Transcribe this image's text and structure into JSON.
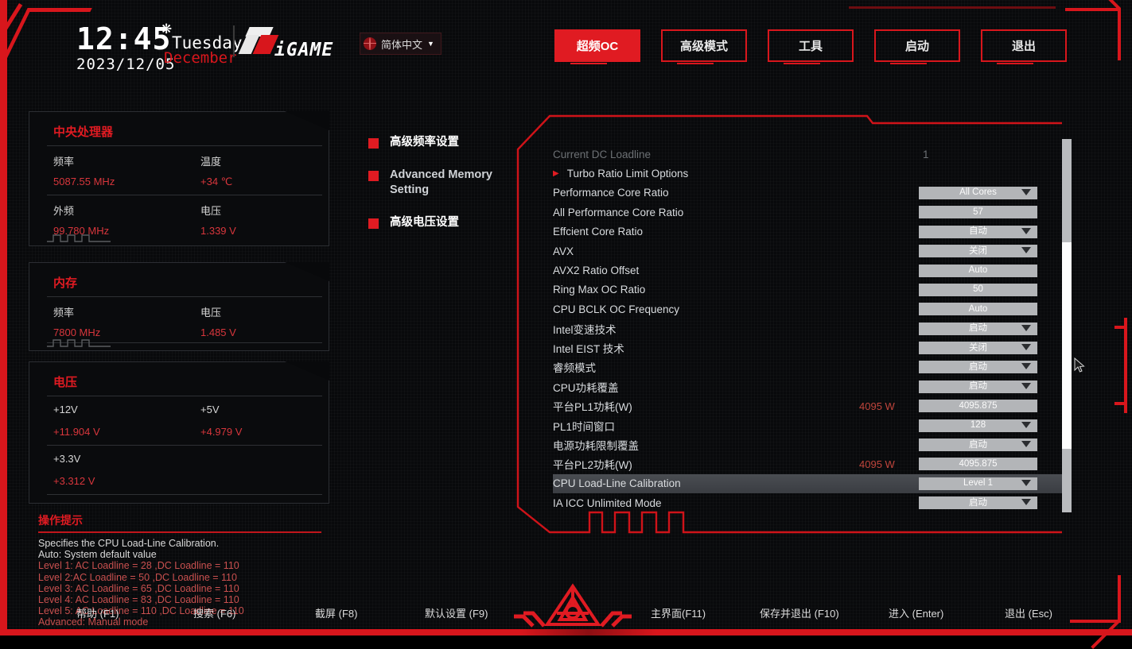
{
  "header": {
    "time": "12:45",
    "date": "2023/12/05",
    "day_of_week": "Tuesday",
    "month": "December",
    "gear_icon": "gear-icon",
    "brand": "iGAME",
    "language": {
      "label": "简体中文",
      "caret": "▼",
      "globe_icon": "globe-icon"
    },
    "nav": [
      {
        "label": "超频OC",
        "active": true
      },
      {
        "label": "高级模式",
        "active": false
      },
      {
        "label": "工具",
        "active": false
      },
      {
        "label": "启动",
        "active": false
      },
      {
        "label": "退出",
        "active": false
      }
    ]
  },
  "sidebar": {
    "cpu": {
      "title": "中央处理器",
      "fields": [
        {
          "label": "频率",
          "value": "5087.55 MHz"
        },
        {
          "label": "温度",
          "value": "+34 ℃"
        },
        {
          "label": "外频",
          "value": "99.780 MHz"
        },
        {
          "label": "电压",
          "value": "1.339 V"
        }
      ]
    },
    "memory": {
      "title": "内存",
      "fields": [
        {
          "label": "频率",
          "value": "7800 MHz"
        },
        {
          "label": "电压",
          "value": "1.485 V"
        }
      ]
    },
    "voltage": {
      "title": "电压",
      "fields": [
        {
          "label": "+12V",
          "value": "+11.904 V"
        },
        {
          "label": "+5V",
          "value": "+4.979 V"
        },
        {
          "label": "+3.3V",
          "value": "+3.312 V"
        }
      ]
    },
    "help": {
      "title": "操作提示",
      "lines": [
        "Specifies the CPU Load-Line Calibration.",
        "Auto: System default value",
        "Level 1: AC Loadline = 28 ,DC Loadline = 110",
        "Level 2:AC Loadline = 50 ,DC Loadline = 110",
        "Level 3: AC Loadline = 65 ,DC Loadline = 110",
        "Level 4: AC Loadline = 83 ,DC Loadline = 110",
        "Level 5: AC Loadline = 110 ,DC Loadline = 110",
        "Advanced: Manual mode"
      ]
    }
  },
  "midmenu": [
    {
      "label": "高级频率设置",
      "lang": "zh"
    },
    {
      "label": "Advanced Memory Setting",
      "lang": "en"
    },
    {
      "label": "高级电压设置",
      "lang": "zh"
    }
  ],
  "settings": {
    "rows": [
      {
        "label": "Current DC Loadline",
        "kind": "readonly",
        "value": "1",
        "dim": true
      },
      {
        "label": "Turbo Ratio Limit Options",
        "kind": "submenu",
        "arrow": "▶"
      },
      {
        "label": "Performance Core Ratio",
        "kind": "dropdown",
        "value": "All Cores"
      },
      {
        "label": "All Performance Core Ratio",
        "kind": "input",
        "value": "57"
      },
      {
        "label": "Effcient Core Ratio",
        "kind": "dropdown",
        "value": "自动"
      },
      {
        "label": "AVX",
        "kind": "dropdown",
        "value": "关闭"
      },
      {
        "label": "AVX2 Ratio Offset",
        "kind": "input",
        "value": "Auto"
      },
      {
        "label": "Ring Max OC Ratio",
        "kind": "input",
        "value": "50"
      },
      {
        "label": "CPU BCLK OC Frequency",
        "kind": "input",
        "value": "Auto"
      },
      {
        "label": "Intel变速技术",
        "kind": "dropdown",
        "value": "启动"
      },
      {
        "label": "Intel EIST 技术",
        "kind": "dropdown",
        "value": "关闭"
      },
      {
        "label": "睿频模式",
        "kind": "dropdown",
        "value": "启动"
      },
      {
        "label": "CPU功耗覆盖",
        "kind": "dropdown",
        "value": "启动"
      },
      {
        "label": "平台PL1功耗(W)",
        "kind": "input",
        "value": "4095.875",
        "side": "4095 W"
      },
      {
        "label": "PL1时间窗口",
        "kind": "dropdown",
        "value": "128"
      },
      {
        "label": "电源功耗限制覆盖",
        "kind": "dropdown",
        "value": "启动"
      },
      {
        "label": "平台PL2功耗(W)",
        "kind": "input",
        "value": "4095.875",
        "side": "4095 W"
      },
      {
        "label": "CPU Load-Line Calibration",
        "kind": "dropdown",
        "value": "Level 1",
        "selected": true
      },
      {
        "label": "IA ICC Unlimited Mode",
        "kind": "dropdown",
        "value": "启动"
      }
    ]
  },
  "footer": {
    "keys": [
      {
        "label": "帮助 (F1)"
      },
      {
        "label": "搜索 (F6)"
      },
      {
        "label": "截屏 (F8)"
      },
      {
        "label": "默认设置 (F9)"
      },
      {
        "label": "主界面(F11)"
      },
      {
        "label": "保存并退出 (F10)"
      },
      {
        "label": "进入 (Enter)"
      },
      {
        "label": "退出 (Esc)"
      }
    ]
  },
  "colors": {
    "accent": "#e01b22",
    "panel_bg": "#0a0b0d",
    "control_bg": "#b3b5b8",
    "value_red": "#d8363c"
  }
}
